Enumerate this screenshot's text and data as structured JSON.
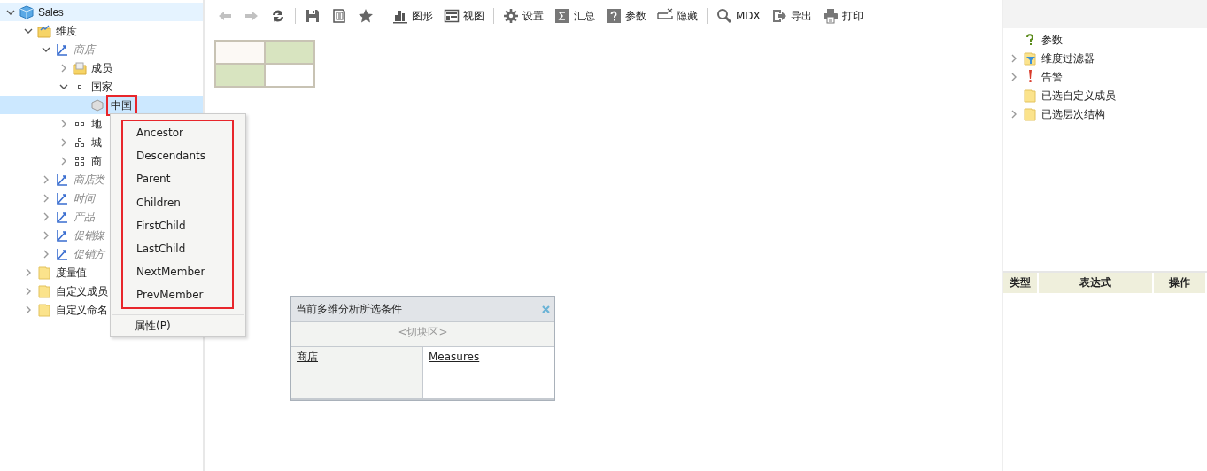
{
  "tree": [
    {
      "label": "Sales",
      "kind": "cube",
      "expanded": true,
      "hovered": true,
      "children": [
        {
          "label": "维度",
          "kind": "dimfolder",
          "expanded": true,
          "children": [
            {
              "label": "商店",
              "kind": "hierarchy",
              "expanded": true,
              "children": [
                {
                  "label": "成员",
                  "kind": "memberfolder",
                  "expanded": false
                },
                {
                  "label": "国家",
                  "kind": "level1",
                  "expanded": true,
                  "children": [
                    {
                      "label": "中国",
                      "kind": "member",
                      "selected": true,
                      "highlighted": true
                    }
                  ]
                },
                {
                  "label": "地",
                  "kind": "level2",
                  "expanded": false
                },
                {
                  "label": "城",
                  "kind": "level3",
                  "expanded": false
                },
                {
                  "label": "商",
                  "kind": "level4",
                  "expanded": false
                }
              ]
            },
            {
              "label": "商店类",
              "kind": "hierarchy",
              "expanded": false
            },
            {
              "label": "时间",
              "kind": "hierarchy",
              "expanded": false
            },
            {
              "label": "产品",
              "kind": "hierarchy",
              "expanded": false
            },
            {
              "label": "促销媒",
              "kind": "hierarchy",
              "expanded": false
            },
            {
              "label": "促销方",
              "kind": "hierarchy",
              "expanded": false
            }
          ]
        },
        {
          "label": "度量值",
          "kind": "folder",
          "expanded": false
        },
        {
          "label": "自定义成员",
          "kind": "folder",
          "expanded": false
        },
        {
          "label": "自定义命名",
          "kind": "folder",
          "expanded": false
        }
      ]
    }
  ],
  "context_menu": {
    "highlighted": true,
    "items": [
      {
        "label": "Ancestor",
        "kind": "mdx"
      },
      {
        "label": "Descendants",
        "kind": "mdx"
      },
      {
        "label": "Parent",
        "kind": "mdx"
      },
      {
        "label": "Children",
        "kind": "mdx"
      },
      {
        "label": "FirstChild",
        "kind": "mdx"
      },
      {
        "label": "LastChild",
        "kind": "mdx"
      },
      {
        "label": "NextMember",
        "kind": "mdx"
      },
      {
        "label": "PrevMember",
        "kind": "mdx"
      },
      {
        "label": "属性(P)",
        "kind": "property"
      }
    ]
  },
  "toolbar": [
    {
      "kind": "back",
      "disabled": true
    },
    {
      "kind": "forward",
      "disabled": true
    },
    {
      "kind": "refresh",
      "disabled": false
    },
    {
      "kind": "sep"
    },
    {
      "kind": "save",
      "disabled": false
    },
    {
      "kind": "saveas",
      "disabled": false
    },
    {
      "kind": "star",
      "disabled": false
    },
    {
      "kind": "sep"
    },
    {
      "kind": "chart",
      "label": "图形",
      "disabled": false
    },
    {
      "kind": "view",
      "label": "视图",
      "disabled": false
    },
    {
      "kind": "sep"
    },
    {
      "kind": "gear",
      "label": "设置",
      "disabled": false
    },
    {
      "kind": "sum",
      "label": "汇总",
      "disabled": false
    },
    {
      "kind": "question",
      "label": "参数",
      "disabled": false
    },
    {
      "kind": "hide",
      "label": "隐藏",
      "disabled": false
    },
    {
      "kind": "sep"
    },
    {
      "kind": "search",
      "label": "MDX",
      "disabled": false
    },
    {
      "kind": "export",
      "label": "导出",
      "disabled": false
    },
    {
      "kind": "print",
      "label": "打印",
      "disabled": false
    }
  ],
  "conditions_panel": {
    "title": "当前多维分析所选条件",
    "slicer": "<切块区>",
    "rows_field": "商店",
    "columns_field": "Measures"
  },
  "right_tree": [
    {
      "label": "参数",
      "kind": "param"
    },
    {
      "label": "维度过滤器",
      "kind": "filter",
      "expanded": false
    },
    {
      "label": "告警",
      "kind": "alert",
      "expanded": false
    },
    {
      "label": "已选自定义成员",
      "kind": "folder"
    },
    {
      "label": "已选层次结构",
      "kind": "folder",
      "expanded": false
    }
  ],
  "expression_table": {
    "columns": [
      "类型",
      "表达式",
      "操作"
    ]
  }
}
